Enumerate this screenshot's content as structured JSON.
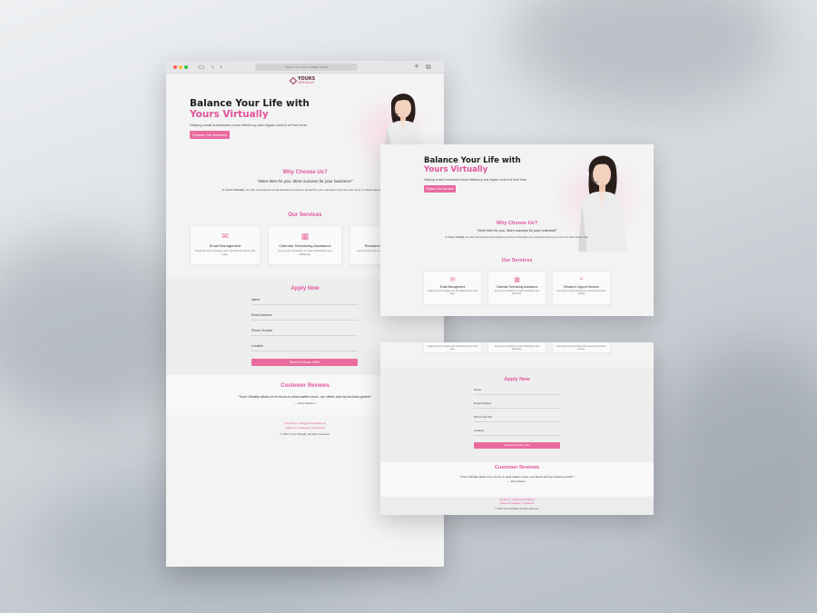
{
  "browser": {
    "url_text": "Search or enter website name",
    "add_tab": "+",
    "tabs_icon": "⧉",
    "sidebar_icon": "▭",
    "back_icon": "‹",
    "forward_icon": "›"
  },
  "logo": {
    "name": "YOURS",
    "sub": "VIRTUALLY"
  },
  "hero": {
    "title_line1": "Balance Your Life with",
    "title_line2": "Yours Virtually",
    "subtitle": "Helping small businesses boost efficiency and regain control of their time.",
    "cta": "Explore Our Services"
  },
  "why": {
    "heading": "Why Choose Us?",
    "quote": "\"More time for you. More success for your business!\"",
    "body_prefix": "At",
    "body_brand": "Yours Virtually",
    "body": ", we offer professional virtual assistant services to streamline your operations and help you focus on what matters most."
  },
  "services": {
    "heading": "Our Services",
    "items": [
      {
        "icon": "email-icon",
        "glyph": "✉",
        "title": "Email Management",
        "desc": "Organize and manage your overflowing inbox with ease."
      },
      {
        "icon": "calendar-icon",
        "glyph": "▦",
        "title": "Calendar Scheduling Assistance",
        "desc": "Keep your schedule on track effortlessly and efficiently."
      },
      {
        "icon": "search-icon",
        "glyph": "⌕",
        "title": "Research Support Services",
        "desc": "Get precise and professional research assistance quickly."
      }
    ]
  },
  "apply": {
    "heading": "Apply Now",
    "fields": [
      "Name",
      "Email Address",
      "Phone Number",
      "Location"
    ],
    "submit": "Submit & Book a Slot"
  },
  "reviews": {
    "heading": "Customer Reviews",
    "quote": "\"Yours Virtually allows me to focus on what matters most—my clients and my business growth.\"",
    "author": "— Ruby Madison"
  },
  "footer": {
    "contact": "Contact us: info@yoursvirtually.ca",
    "follow": "Follow us: Instagram | Facebook",
    "copyright": "© 2024 Yours Virtually. All rights reserved."
  },
  "colors": {
    "accent": "#e0559a",
    "button": "#e86a9f",
    "background": "#f3f3f4"
  }
}
